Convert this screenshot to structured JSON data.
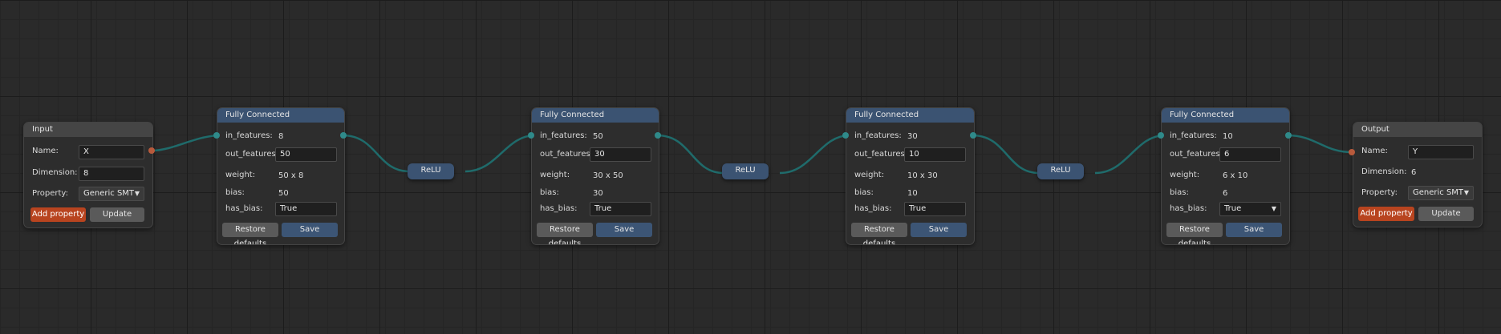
{
  "input_node": {
    "title": "Input",
    "name_label": "Name:",
    "name_value": "X",
    "dimension_label": "Dimension:",
    "dimension_value": "8",
    "property_label": "Property:",
    "property_value": "Generic SMT",
    "add_property_label": "Add property",
    "update_label": "Update"
  },
  "fc_labels": {
    "title": "Fully Connected",
    "in_features": "in_features:",
    "out_features": "out_features:",
    "weight": "weight:",
    "bias": "bias:",
    "has_bias": "has_bias:",
    "restore": "Restore defaults",
    "save": "Save"
  },
  "fc_nodes": [
    {
      "in_features": "8",
      "out_features": "50",
      "weight": "50 x 8",
      "bias": "50",
      "has_bias": "True"
    },
    {
      "in_features": "50",
      "out_features": "30",
      "weight": "30 x 50",
      "bias": "30",
      "has_bias": "True"
    },
    {
      "in_features": "30",
      "out_features": "10",
      "weight": "10 x 30",
      "bias": "10",
      "has_bias": "True"
    },
    {
      "in_features": "10",
      "out_features": "6",
      "weight": "6 x 10",
      "bias": "6",
      "has_bias": "True"
    }
  ],
  "relu_nodes": [
    {
      "label": "ReLU"
    },
    {
      "label": "ReLU"
    },
    {
      "label": "ReLU"
    }
  ],
  "output_node": {
    "title": "Output",
    "name_label": "Name:",
    "name_value": "Y",
    "dimension_label": "Dimension:",
    "dimension_value": "6",
    "property_label": "Property:",
    "property_value": "Generic SMT",
    "add_property_label": "Add property",
    "update_label": "Update"
  },
  "colors": {
    "canvas_bg": "#2a2a2a",
    "node_bg": "#2d2d2d",
    "fc_header": "#3b5372",
    "io_header": "#454545",
    "wire": "#1f6b6b",
    "accent_orange": "#b8441f"
  }
}
